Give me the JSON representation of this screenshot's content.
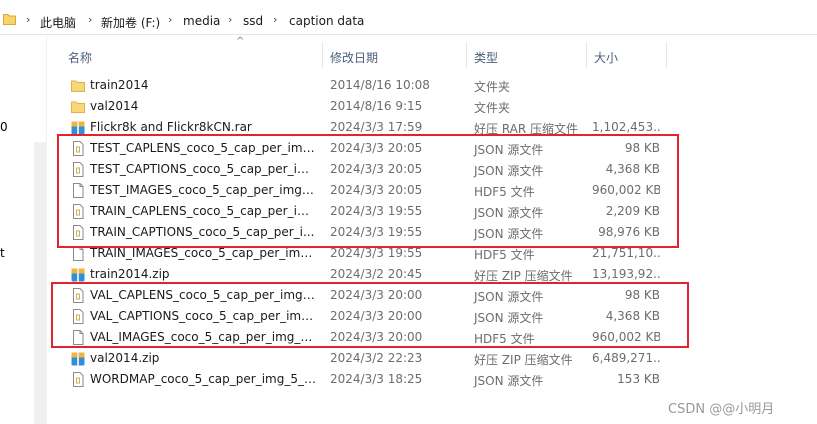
{
  "address_bar": {
    "crumbs": [
      "此电脑",
      "新加卷 (F:)",
      "media",
      "ssd",
      "caption data"
    ],
    "separator": "›"
  },
  "left_pane_glyphs": [
    "0",
    "t"
  ],
  "columns": {
    "name": "名称",
    "date": "修改日期",
    "type": "类型",
    "size": "大小"
  },
  "files": [
    {
      "name": "train2014",
      "date": "2014/8/16 10:08",
      "type": "文件夹",
      "size": "",
      "icon": "folder-icon"
    },
    {
      "name": "val2014",
      "date": "2014/8/16 9:15",
      "type": "文件夹",
      "size": "",
      "icon": "folder-icon"
    },
    {
      "name": "Flickr8k and Flickr8kCN.rar",
      "date": "2024/3/3 17:59",
      "type": "好压 RAR 压缩文件",
      "size": "1,102,453...",
      "icon": "archive-icon"
    },
    {
      "name": "TEST_CAPLENS_coco_5_cap_per_img_...",
      "date": "2024/3/3 20:05",
      "type": "JSON 源文件",
      "size": "98 KB",
      "icon": "json-file-icon"
    },
    {
      "name": "TEST_CAPTIONS_coco_5_cap_per_img...",
      "date": "2024/3/3 20:05",
      "type": "JSON 源文件",
      "size": "4,368 KB",
      "icon": "json-file-icon"
    },
    {
      "name": "TEST_IMAGES_coco_5_cap_per_img_5...",
      "date": "2024/3/3 20:05",
      "type": "HDF5 文件",
      "size": "960,002 KB",
      "icon": "file-icon"
    },
    {
      "name": "TRAIN_CAPLENS_coco_5_cap_per_im...",
      "date": "2024/3/3 19:55",
      "type": "JSON 源文件",
      "size": "2,209 KB",
      "icon": "json-file-icon"
    },
    {
      "name": "TRAIN_CAPTIONS_coco_5_cap_per_i...",
      "date": "2024/3/3 19:55",
      "type": "JSON 源文件",
      "size": "98,976 KB",
      "icon": "json-file-icon"
    },
    {
      "name": "TRAIN_IMAGES_coco_5_cap_per_img_...",
      "date": "2024/3/3 19:55",
      "type": "HDF5 文件",
      "size": "21,751,10...",
      "icon": "file-icon"
    },
    {
      "name": "train2014.zip",
      "date": "2024/3/2 20:45",
      "type": "好压 ZIP 压缩文件",
      "size": "13,193,92...",
      "icon": "archive-icon"
    },
    {
      "name": "VAL_CAPLENS_coco_5_cap_per_img_5...",
      "date": "2024/3/3 20:00",
      "type": "JSON 源文件",
      "size": "98 KB",
      "icon": "json-file-icon"
    },
    {
      "name": "VAL_CAPTIONS_coco_5_cap_per_img_...",
      "date": "2024/3/3 20:00",
      "type": "JSON 源文件",
      "size": "4,368 KB",
      "icon": "json-file-icon"
    },
    {
      "name": "VAL_IMAGES_coco_5_cap_per_img_5_...",
      "date": "2024/3/3 20:00",
      "type": "HDF5 文件",
      "size": "960,002 KB",
      "icon": "file-icon"
    },
    {
      "name": "val2014.zip",
      "date": "2024/3/2 22:23",
      "type": "好压 ZIP 压缩文件",
      "size": "6,489,271...",
      "icon": "archive-icon"
    },
    {
      "name": "WORDMAP_coco_5_cap_per_img_5_m...",
      "date": "2024/3/3 18:25",
      "type": "JSON 源文件",
      "size": "153 KB",
      "icon": "json-file-icon"
    }
  ],
  "highlight_color": "#e0232e",
  "watermark": "CSDN @@小明月"
}
